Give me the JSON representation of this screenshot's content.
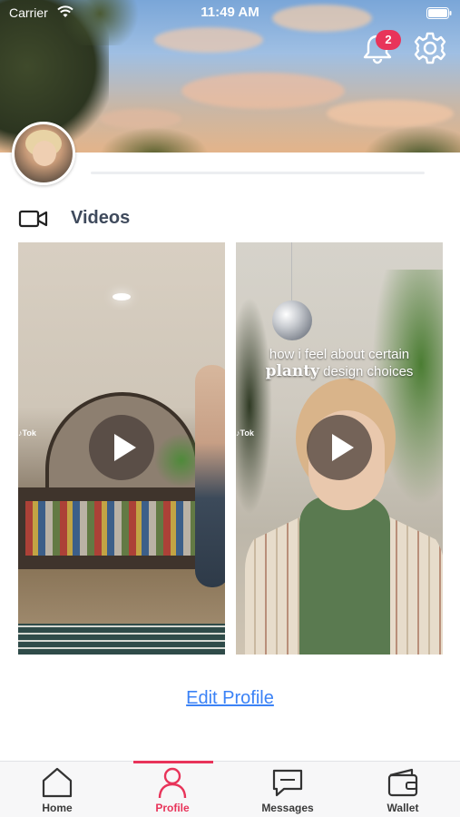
{
  "status_bar": {
    "carrier": "Carrier",
    "time": "11:49 AM"
  },
  "header": {
    "notification_count": "2"
  },
  "videos_section": {
    "title": "Videos",
    "items": [
      {
        "caption": "",
        "tag": "♪Tok"
      },
      {
        "caption_line1": "how i feel about certain",
        "caption_bold": "planty",
        "caption_rest": " design choices",
        "tag": "♪Tok"
      }
    ]
  },
  "actions": {
    "edit_profile": "Edit Profile"
  },
  "tab_bar": {
    "active": "Profile",
    "items": [
      {
        "label": "Home",
        "icon": "home-icon"
      },
      {
        "label": "Profile",
        "icon": "profile-icon"
      },
      {
        "label": "Messages",
        "icon": "messages-icon"
      },
      {
        "label": "Wallet",
        "icon": "wallet-icon"
      }
    ]
  },
  "colors": {
    "accent": "#e8345a",
    "link": "#3b82f6",
    "heading": "#3f4a5c"
  }
}
